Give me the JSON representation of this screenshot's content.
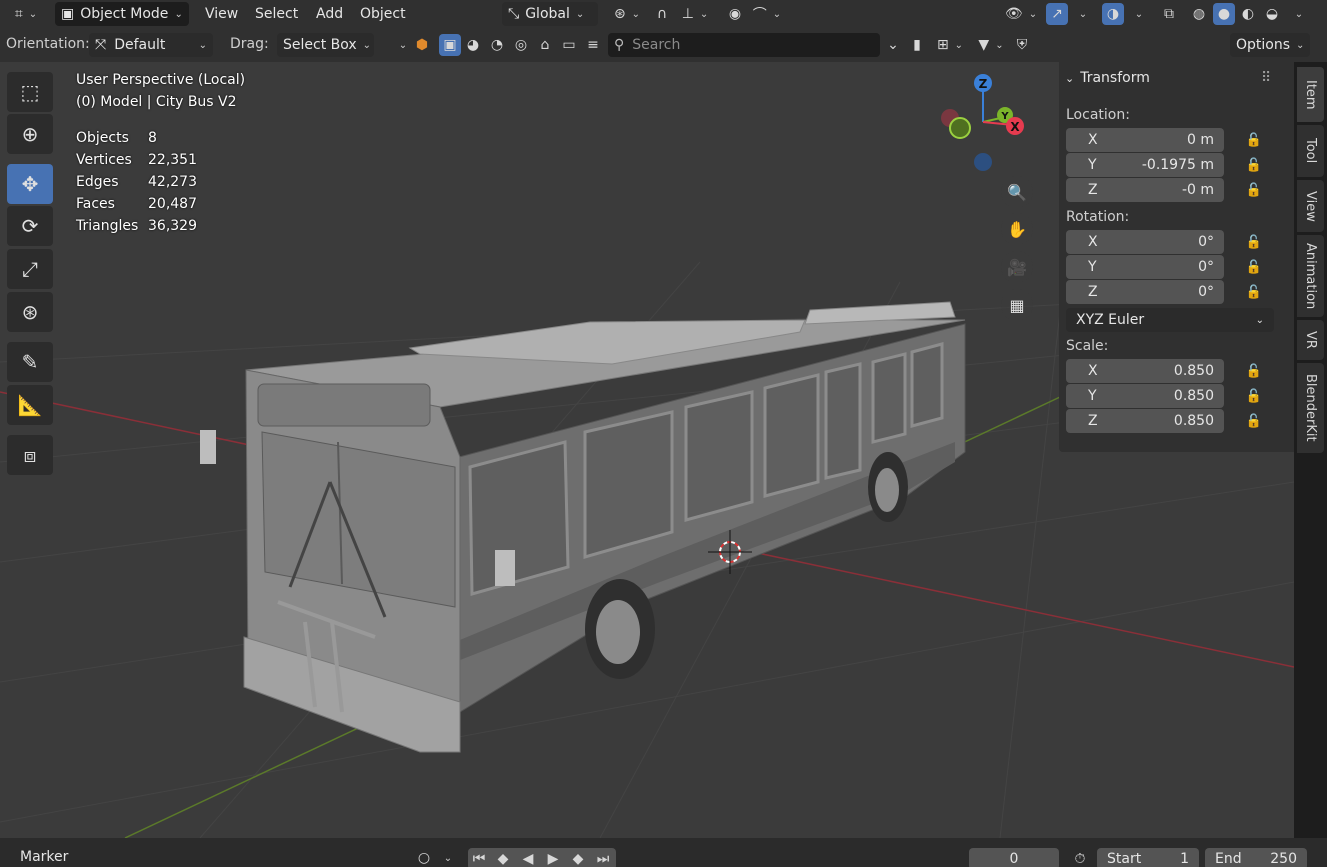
{
  "header": {
    "editor_icon": "editor-type-icon",
    "mode": "Object Mode",
    "menus": [
      "View",
      "Select",
      "Add",
      "Object"
    ],
    "transform_orientation": "Global"
  },
  "tool_settings": {
    "orientation_label": "Orientation:",
    "orientation_value": "Default",
    "drag_label": "Drag:",
    "drag_value": "Select Box",
    "search_placeholder": "Search",
    "options_label": "Options"
  },
  "overlay": {
    "view_name": "User Perspective (Local)",
    "collection": "(0) Model | City Bus V2",
    "stats": [
      {
        "label": "Objects",
        "value": "8"
      },
      {
        "label": "Vertices",
        "value": "22,351"
      },
      {
        "label": "Edges",
        "value": "42,273"
      },
      {
        "label": "Faces",
        "value": "20,487"
      },
      {
        "label": "Triangles",
        "value": "36,329"
      }
    ]
  },
  "gizmo": {
    "z": "Z",
    "y": "Y",
    "x": "X"
  },
  "npanel": {
    "title": "Transform",
    "location_label": "Location:",
    "location": [
      {
        "axis": "X",
        "value": "0 m"
      },
      {
        "axis": "Y",
        "value": "-0.1975 m"
      },
      {
        "axis": "Z",
        "value": "-0 m"
      }
    ],
    "rotation_label": "Rotation:",
    "rotation": [
      {
        "axis": "X",
        "value": "0°"
      },
      {
        "axis": "Y",
        "value": "0°"
      },
      {
        "axis": "Z",
        "value": "0°"
      }
    ],
    "rotation_mode": "XYZ Euler",
    "scale_label": "Scale:",
    "scale": [
      {
        "axis": "X",
        "value": "0.850"
      },
      {
        "axis": "Y",
        "value": "0.850"
      },
      {
        "axis": "Z",
        "value": "0.850"
      }
    ]
  },
  "sidebar_tabs": [
    "Item",
    "Tool",
    "View",
    "Animation",
    "VR",
    "BlenderKit"
  ],
  "timeline": {
    "marker_label": "Marker",
    "current_frame": "0",
    "start_label": "Start",
    "start_value": "1",
    "end_label": "End",
    "end_value": "250"
  },
  "colors": {
    "accent": "#4772b3",
    "axis_x": "#e63b4f",
    "axis_y": "#7bb52a",
    "axis_z": "#3a80d9"
  }
}
